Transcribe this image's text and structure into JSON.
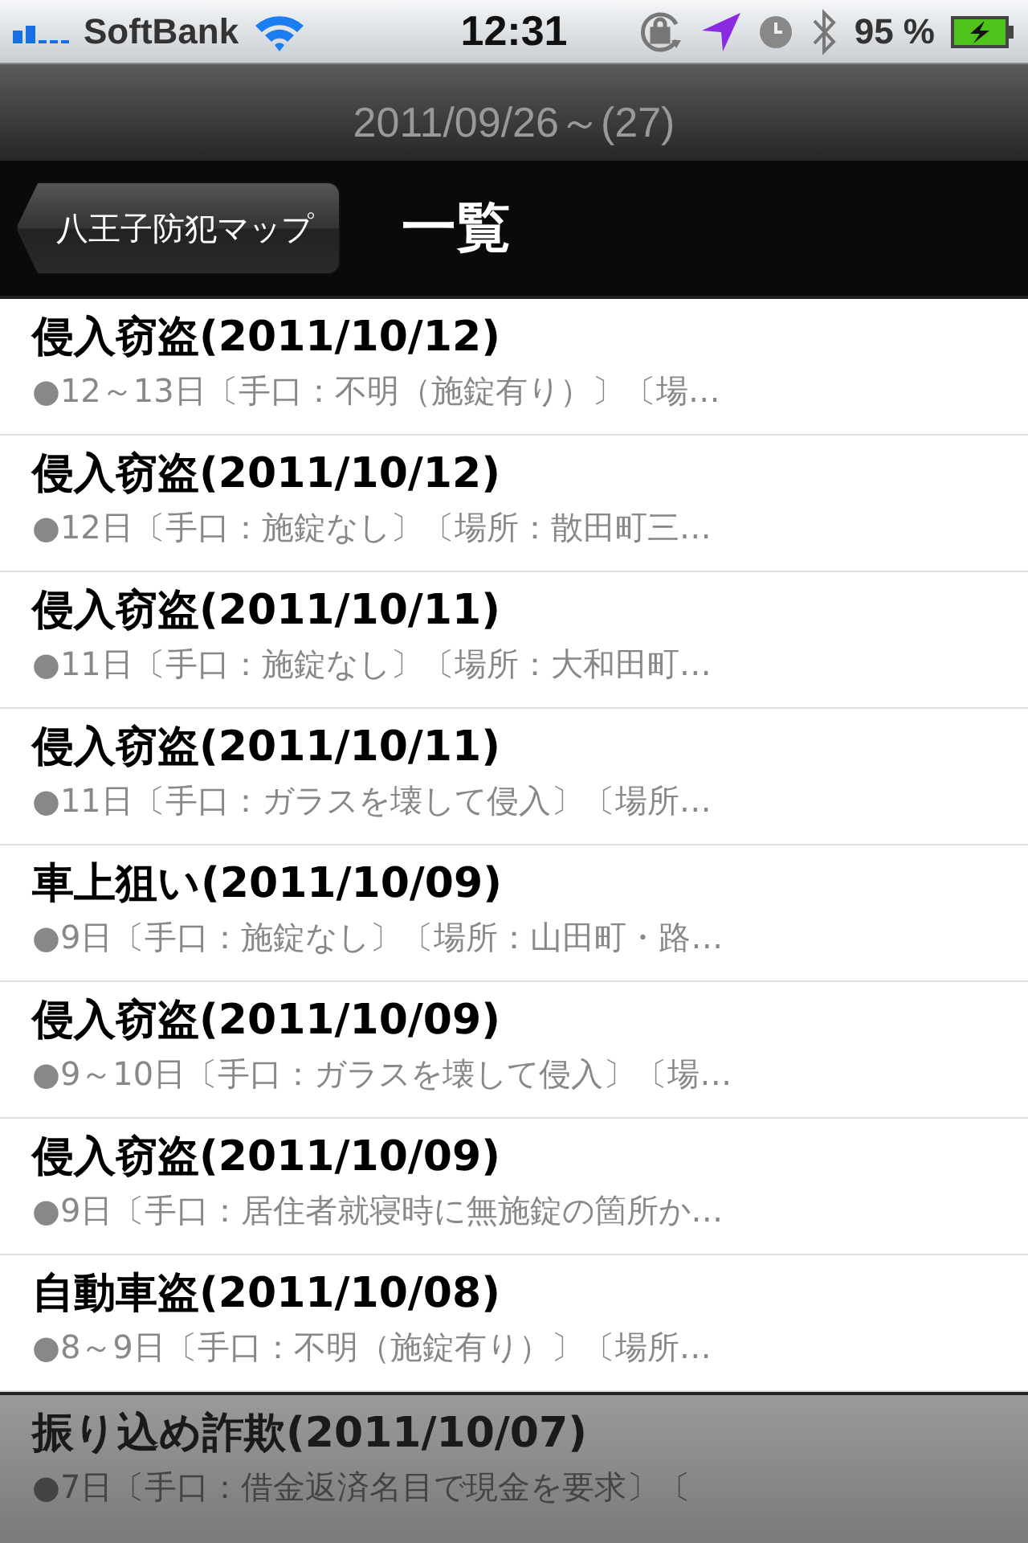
{
  "status_bar": {
    "carrier": "SoftBank",
    "time": "12:31",
    "battery": "95 %"
  },
  "prompt": "2011/09/26～(27)",
  "nav_bar": {
    "back_button": "八王子防犯マップ",
    "title": "一覧"
  },
  "rows": [
    {
      "title": "侵入窃盗(2011/10/12)",
      "subtitle": "●12～13日〔手口：不明（施錠有り）〕〔場…"
    },
    {
      "title": "侵入窃盗(2011/10/12)",
      "subtitle": "●12日〔手口：施錠なし〕〔場所：散田町三…"
    },
    {
      "title": "侵入窃盗(2011/10/11)",
      "subtitle": "●11日〔手口：施錠なし〕〔場所：大和田町…"
    },
    {
      "title": "侵入窃盗(2011/10/11)",
      "subtitle": "●11日〔手口：ガラスを壊して侵入〕〔場所…"
    },
    {
      "title": "車上狙い(2011/10/09)",
      "subtitle": "●9日〔手口：施錠なし〕〔場所：山田町・路…"
    },
    {
      "title": "侵入窃盗(2011/10/09)",
      "subtitle": "●9～10日〔手口：ガラスを壊して侵入〕〔場…"
    },
    {
      "title": "侵入窃盗(2011/10/09)",
      "subtitle": "●9日〔手口：居住者就寝時に無施錠の箇所か…"
    },
    {
      "title": "自動車盗(2011/10/08)",
      "subtitle": "●8～9日〔手口：不明（施錠有り）〕〔場所…"
    },
    {
      "title": "振り込め詐欺(2011/10/07)",
      "subtitle": "●7日〔手口：借金返済名目で現金を要求〕〔"
    }
  ]
}
